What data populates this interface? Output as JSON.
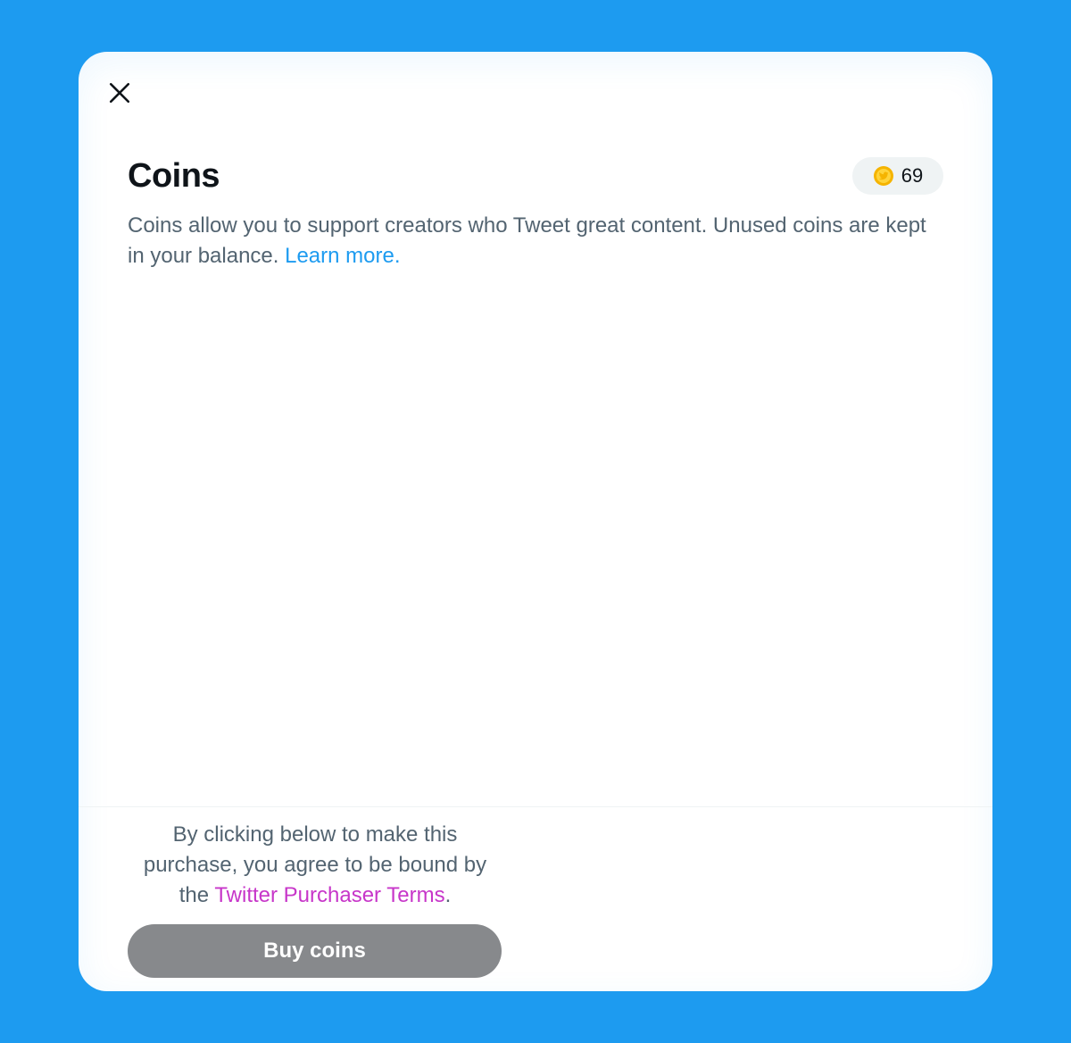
{
  "modal": {
    "close_label": "Close",
    "title": "Coins",
    "balance": "69",
    "description_text": "Coins allow you to support creators who Tweet great content. Unused coins are kept in your balance. ",
    "learn_more_link": "Learn more.",
    "terms_prefix": "By clicking below to make this purchase, you agree to be bound by the ",
    "terms_link": "Twitter Purchaser Terms",
    "terms_suffix": ".",
    "buy_button_label": "Buy coins"
  },
  "colors": {
    "background": "#1d9bf0",
    "link": "#1d9bf0",
    "terms_link": "#c736c9",
    "button": "#87898c",
    "coin": "#f5b400"
  },
  "icons": {
    "close": "close-icon",
    "coin": "coin-icon"
  }
}
